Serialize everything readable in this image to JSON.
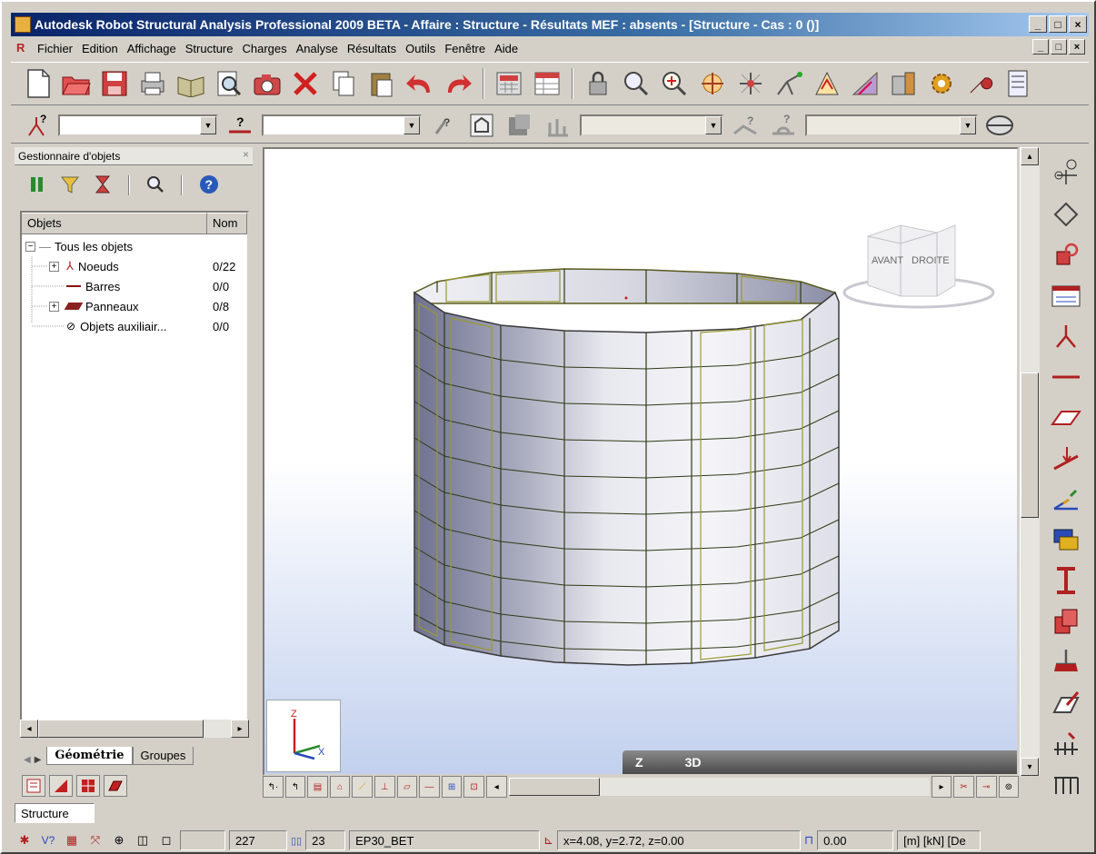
{
  "window": {
    "title": "Autodesk Robot Structural Analysis Professional 2009 BETA - Affaire : Structure - Résultats MEF : absents - [Structure - Cas : 0 ()]",
    "minimize": "_",
    "maximize": "□",
    "close": "×"
  },
  "menu": {
    "items": [
      "Fichier",
      "Edition",
      "Affichage",
      "Structure",
      "Charges",
      "Analyse",
      "Résultats",
      "Outils",
      "Fenêtre",
      "Aide"
    ]
  },
  "toolbar1": {
    "icons": [
      "new-file",
      "open-folder",
      "save-disk",
      "print",
      "book",
      "print-preview",
      "camera",
      "delete-x",
      "copy",
      "paste",
      "undo",
      "redo",
      "calculator",
      "data-table",
      "lock",
      "zoom",
      "zoom-window",
      "pan",
      "snap",
      "structural-view",
      "grid",
      "model-tree",
      "settings-gear",
      "wrench",
      "layout"
    ]
  },
  "toolbar2": {
    "combo1": "",
    "combo2": "",
    "combo3": "",
    "combo4": ""
  },
  "object_manager": {
    "title": "Gestionnaire d'objets",
    "col_objects": "Objets",
    "col_number": "Nom",
    "root": "Tous les objets",
    "items": [
      {
        "label": "Noeuds",
        "value": "0/22",
        "expandable": true
      },
      {
        "label": "Barres",
        "value": "0/0",
        "expandable": false
      },
      {
        "label": "Panneaux",
        "value": "0/8",
        "expandable": true
      },
      {
        "label": "Objets auxiliair...",
        "value": "0/0",
        "expandable": false
      }
    ],
    "tabs": [
      "Géométrie",
      "Groupes"
    ]
  },
  "viewport": {
    "view_label_z": "Z",
    "view_label_3d": "3D",
    "cube_front": "AVANT",
    "cube_right": "DROITE",
    "axis_z": "Z",
    "axis_x": "X"
  },
  "status": {
    "structure": "Structure",
    "count": "227",
    "count2": "23",
    "material": "EP30_BET",
    "coords": "x=4.08, y=2.72, z=0.00",
    "value": "0.00",
    "units": "[m] [kN] [De"
  },
  "colors": {
    "title_start": "#0a246a",
    "title_end": "#a6caf0",
    "panel_edge": "#6b6b1e",
    "tank_dark": "#7a7d96",
    "tank_light": "#f2f2f6"
  }
}
